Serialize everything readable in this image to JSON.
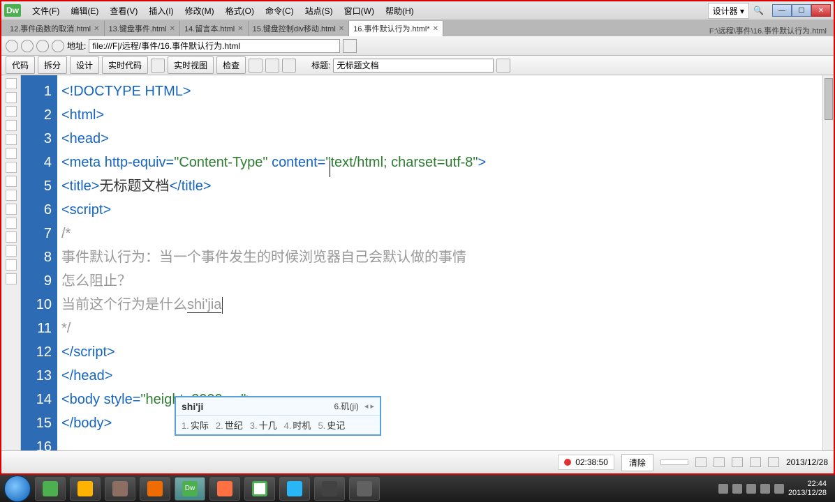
{
  "app": {
    "logo": "Dw",
    "menus": [
      "文件(F)",
      "编辑(E)",
      "查看(V)",
      "插入(I)",
      "修改(M)",
      "格式(O)",
      "命令(C)",
      "站点(S)",
      "窗口(W)",
      "帮助(H)"
    ],
    "mode_dropdown": "设计器",
    "search_icon": "🔍"
  },
  "tabs": {
    "items": [
      {
        "label": "12.事件函数的取消.html",
        "active": false
      },
      {
        "label": "13.键盘事件.html",
        "active": false
      },
      {
        "label": "14.留言本.html",
        "active": false
      },
      {
        "label": "15.键盘控制div移动.html",
        "active": false
      },
      {
        "label": "16.事件默认行为.html*",
        "active": true
      }
    ],
    "path": "F:\\远程\\事件\\16.事件默认行为.html"
  },
  "address": {
    "label": "地址:",
    "value": "file:///F|/远程/事件/16.事件默认行为.html"
  },
  "toolbar2": {
    "btn_code": "代码",
    "btn_split": "拆分",
    "btn_design": "设计",
    "btn_live_code": "实时代码",
    "btn_live_view": "实时视图",
    "btn_inspect": "检查",
    "title_label": "标题:",
    "title_value": "无标题文档"
  },
  "code": {
    "lines": [
      {
        "n": "1",
        "html": "<span class='hl-tag'>&lt;!DOCTYPE HTML&gt;</span>"
      },
      {
        "n": "2",
        "html": "<span class='hl-tag'>&lt;html&gt;</span>"
      },
      {
        "n": "3",
        "html": "<span class='hl-tag'>&lt;head&gt;</span>"
      },
      {
        "n": "4",
        "html": "<span class='hl-tag'>&lt;meta </span><span class='hl-attr'>http-equiv=</span><span class='hl-str'>\"Content-Type\"</span><span class='hl-tag'> </span><span class='hl-attr'>content=</span><span class='hl-str'>\"text/html; charset=utf-8\"</span><span class='hl-tag'>&gt;</span>"
      },
      {
        "n": "5",
        "html": "<span class='hl-tag'>&lt;title&gt;</span><span class='hl-txt'>无标题文档</span><span class='hl-tag'>&lt;/title&gt;</span>"
      },
      {
        "n": "6",
        "html": "<span class='hl-tag'>&lt;script&gt;</span>"
      },
      {
        "n": "7",
        "html": "<span class='hl-comm'>/*</span>"
      },
      {
        "n": "8",
        "html": "<span class='hl-comm'>事件默认行为：当一个事件发生的时候浏览器自己会默认做的事情</span>"
      },
      {
        "n": "9",
        "html": "<span class='hl-comm'>怎么阻止？</span>"
      },
      {
        "n": "10",
        "html": "<span class='hl-comm'>当前这个行为是什么</span><span class='hl-comm ime-underline'>shi'jia</span><span class='cursor-caret'></span>"
      },
      {
        "n": "11",
        "html": "<span class='hl-comm'>*/</span>"
      },
      {
        "n": "12",
        "html": "<span class='hl-tag'>&lt;/script&gt;</span>"
      },
      {
        "n": "13",
        "html": "<span class='hl-tag'>&lt;/head&gt;</span>"
      },
      {
        "n": "14",
        "html": ""
      },
      {
        "n": "15",
        "html": "<span class='hl-tag'>&lt;body </span><span class='hl-attr'>style=</span><span class='hl-str'>\"height: 2000px;\"</span><span class='hl-tag'>&gt;</span>"
      },
      {
        "n": "16",
        "html": "<span class='hl-tag'>&lt;/body&gt;</span>"
      }
    ]
  },
  "ime": {
    "input": "shi'ji",
    "alt": "6.矶(ji)",
    "candidates": [
      {
        "n": "1",
        "w": "实际"
      },
      {
        "n": "2",
        "w": "世纪"
      },
      {
        "n": "3",
        "w": "十几"
      },
      {
        "n": "4",
        "w": "时机"
      },
      {
        "n": "5",
        "w": "史记"
      }
    ]
  },
  "status": {
    "rec_time": "02:38:50",
    "btn_clear": "清除",
    "date": "2013/12/28"
  },
  "taskbar": {
    "time": "22:44",
    "date": "2013/12/28"
  }
}
